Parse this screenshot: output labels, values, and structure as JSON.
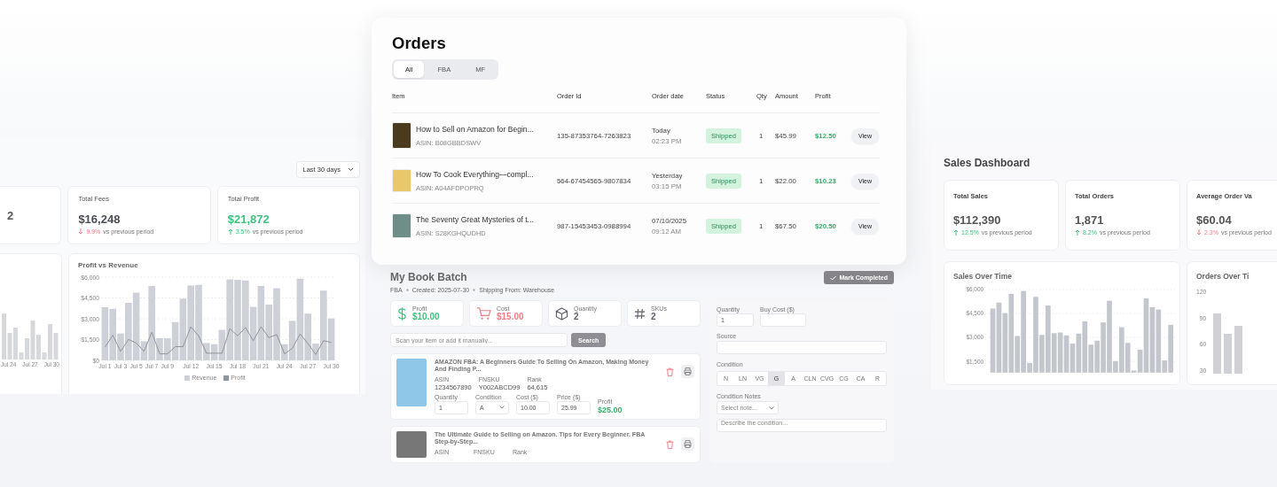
{
  "analytics_panel": {
    "range_select": "Last 30 days",
    "stat_cards": [
      {
        "value": "2",
        "color": "#55585f"
      },
      {
        "label": "Total Fees",
        "value": "$16,248",
        "color": "#4a4d55",
        "rising": false,
        "change": "9.9%",
        "note": "vs previous period"
      },
      {
        "label": "Total Profit",
        "value": "$21,872",
        "color": "#3fc27d",
        "rising": true,
        "change": "3.5%",
        "note": "vs previous period"
      }
    ],
    "side_chart": {
      "x_labels": [
        "Jul 24",
        "Jul 27",
        "Jul 30"
      ]
    },
    "chart": {
      "chart_data": {
        "type": "bar",
        "title": "Profit vs Revenue",
        "categories": [
          "Jul 1",
          null,
          "Jul 3",
          null,
          "Jul 5",
          null,
          "Jul 7",
          null,
          "Jul 9",
          null,
          null,
          "Jul 12",
          null,
          null,
          "Jul 15",
          null,
          null,
          "Jul 18",
          null,
          null,
          "Jul 21",
          null,
          null,
          "Jul 24",
          null,
          null,
          "Jul 27",
          null,
          null,
          "Jul 30"
        ],
        "series": [
          {
            "name": "Revenue",
            "color": "#cdd0d6",
            "type": "bar",
            "values": [
              3840,
              3710,
              1940,
              4150,
              4880,
              1380,
              5360,
              1600,
              1600,
              2760,
              4450,
              5400,
              5440,
              1250,
              1170,
              2200,
              5830,
              5810,
              5760,
              3860,
              5370,
              4020,
              5200,
              1170,
              2850,
              5890,
              3370,
              1210,
              5030,
              3020
            ]
          },
          {
            "name": "Profit",
            "color": "#8f959e",
            "type": "line",
            "values": [
              950,
              1810,
              650,
              1510,
              1250,
              650,
              2030,
              470,
              470,
              990,
              990,
              2420,
              1770,
              520,
              520,
              520,
              2290,
              1770,
              2370,
              1420,
              2420,
              1640,
              1860,
              470,
              860,
              1900,
              1210,
              430,
              1420,
              1300
            ]
          }
        ],
        "ylim": [
          0,
          6000
        ],
        "grid": true,
        "yticks": [
          {
            "value": 0,
            "label": "$0"
          },
          {
            "value": 1500,
            "label": "$1,500"
          },
          {
            "value": 3000,
            "label": "$3,000"
          },
          {
            "value": 4500,
            "label": "$4,500"
          },
          {
            "value": 6000,
            "label": "$6,000"
          }
        ]
      }
    }
  },
  "orders": {
    "title": "Orders",
    "tabs": [
      {
        "label": "All",
        "selected": true
      },
      {
        "label": "FBA",
        "selected": false
      },
      {
        "label": "MF",
        "selected": false
      }
    ],
    "columns": [
      "Item",
      "Order Id",
      "Order date",
      "Status",
      "Qty",
      "Amount",
      "Profit"
    ],
    "rows": [
      {
        "title": "How to Sell on Amazon for Begin...",
        "asin": "ASIN: B08GBBDSWV",
        "order_id": "135-87353764-7263823",
        "date": "Today",
        "time": "02:23 PM",
        "status": "Shipped",
        "qty": "1",
        "amount": "$45.99",
        "profit": "$12.50",
        "action": "View"
      },
      {
        "title": "How To Cook Everything—compl...",
        "asin": "ASIN: A04AFDPOPRQ",
        "order_id": "564-67454565-9807834",
        "date": "Yesterday",
        "time": "03:15 PM",
        "status": "Shipped",
        "qty": "1",
        "amount": "$22.00",
        "profit": "$10.23",
        "action": "View"
      },
      {
        "title": "The Seventy Great Mysteries of t...",
        "asin": "ASIN: S28KGHQUDHD",
        "order_id": "987-15453453-0988994",
        "date": "07/10/2025",
        "time": "09:12 AM",
        "status": "Shipped",
        "qty": "1",
        "amount": "$67.50",
        "profit": "$20.50",
        "action": "View"
      }
    ]
  },
  "batch": {
    "title": "My Book Batch",
    "meta": [
      "FBA",
      "Created: 2025-07-30",
      "Shipping From: Warehouse"
    ],
    "complete_button": "Mark Completed",
    "stats": [
      {
        "kind": "dollar",
        "label": "Profit",
        "value": "$10.00",
        "color": "#3fc27d"
      },
      {
        "kind": "cart",
        "label": "Cost",
        "value": "$15.00",
        "color": "#ef7f86"
      },
      {
        "kind": "box",
        "label": "Quantity",
        "value": "2",
        "color": "#5f6168"
      },
      {
        "kind": "hash",
        "label": "SKUs",
        "value": "2",
        "color": "#5f6168"
      }
    ],
    "search": {
      "placeholder": "Scan your item or add it manually...",
      "button": "Search"
    },
    "items": [
      {
        "title": "AMAZON FBA: A Beginners Guide To Selling On Amazon, Making Money And Finding P...",
        "info": [
          {
            "label": "ASIN",
            "value": "1234567890"
          },
          {
            "label": "FNSKU",
            "value": "Y002ABCD99"
          },
          {
            "label": "Rank",
            "value": "64,615"
          }
        ],
        "inputs": [
          {
            "label": "Quantity",
            "value": "1",
            "kind": "text"
          },
          {
            "label": "Condition",
            "value": "A",
            "kind": "select"
          },
          {
            "label": "Cost ($)",
            "value": "10.00",
            "kind": "text"
          },
          {
            "label": "Price ($)",
            "value": "25.99",
            "kind": "text"
          }
        ],
        "profit_label": "Profit",
        "profit": "$25.00"
      },
      {
        "title": "The Ultimate Guide to Selling on Amazon. Tips for Every Beginner. FBA Step-by-Step...",
        "info": [
          {
            "label": "ASIN"
          },
          {
            "label": "FNSKU"
          },
          {
            "label": "Rank"
          }
        ]
      }
    ],
    "form": {
      "quantity_label": "Quantity",
      "quantity": "1",
      "buy_cost_label": "Buy Cost ($)",
      "source_label": "Source",
      "condition_label": "Condition",
      "conditions": [
        {
          "label": "N",
          "selected": false
        },
        {
          "label": "LN",
          "selected": false
        },
        {
          "label": "VG",
          "selected": false
        },
        {
          "label": "G",
          "selected": true
        },
        {
          "label": "A",
          "selected": false
        },
        {
          "label": "CLN",
          "selected": false
        },
        {
          "label": "CVG",
          "selected": false
        },
        {
          "label": "CG",
          "selected": false
        },
        {
          "label": "CA",
          "selected": false
        },
        {
          "label": "R",
          "selected": false
        }
      ],
      "notes_label": "Condition Notes",
      "notes_placeholder": "Select note...",
      "describe_placeholder": "Describe the condition..."
    }
  },
  "sales_dashboard": {
    "title": "Sales Dashboard",
    "stat_cards": [
      {
        "label": "Total Sales",
        "value": "$112,390",
        "rising": true,
        "change": "12.5%",
        "note": "vs previous period"
      },
      {
        "label": "Total Orders",
        "value": "1,871",
        "rising": true,
        "change": "8.2%",
        "note": "vs previous period"
      },
      {
        "label": "Average Order Va",
        "value": "$60.04",
        "rising": false,
        "change": "2.3%",
        "note": "vs previous period"
      }
    ],
    "charts": [
      {
        "chart_data": {
          "type": "bar",
          "title": "Sales Over Time",
          "values": [
            4810,
            5180,
            4520,
            5730,
            3090,
            5910,
            1410,
            5540,
            3160,
            5000,
            3270,
            3310,
            3130,
            2620,
            3240,
            4010,
            2550,
            2800,
            3940,
            5300,
            1520,
            3640,
            2660,
            930,
            2240,
            5450,
            4900,
            4750,
            1560,
            3790
          ],
          "ylim": [
            800,
            6000
          ],
          "grid": true,
          "yticks": [
            {
              "value": 1500,
              "label": "$1,500"
            },
            {
              "value": 3000,
              "label": "$3,000"
            },
            {
              "value": 4500,
              "label": "$4,500"
            },
            {
              "value": 6000,
              "label": "$6,000"
            }
          ]
        }
      },
      {
        "title": "Orders Over Ti",
        "y_labels": [
          "120",
          "90",
          "60",
          "30"
        ]
      }
    ]
  }
}
